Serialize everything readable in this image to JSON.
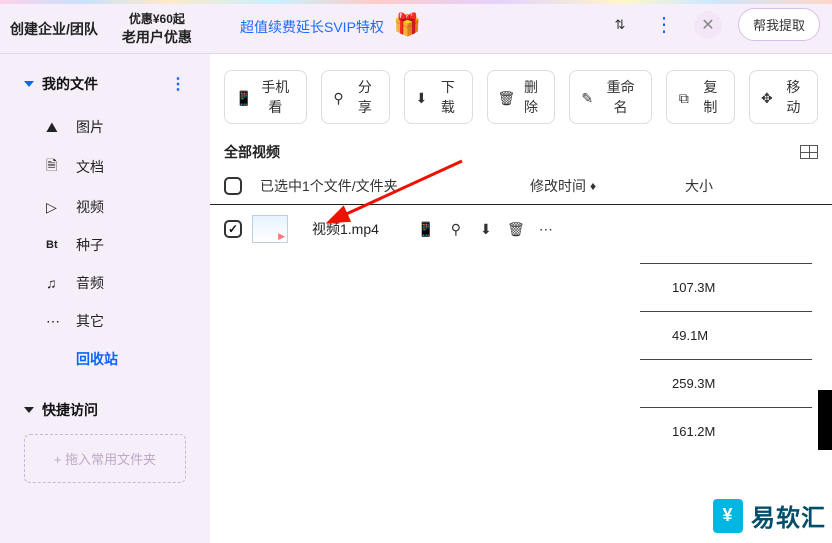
{
  "header": {
    "create_org": "创建企业/团队",
    "promo_top": "优惠¥60起",
    "promo_bottom": "老用户优惠",
    "svip_promo": "超值续费延长SVIP特权",
    "help_placeholder": "帮我提取"
  },
  "sidebar": {
    "my_files_title": "我的文件",
    "items": [
      {
        "icon": "picture-icon",
        "label": "图片"
      },
      {
        "icon": "document-icon",
        "label": "文档"
      },
      {
        "icon": "video-icon",
        "label": "视频"
      },
      {
        "icon": "bt-icon",
        "label": "种子"
      },
      {
        "icon": "audio-icon",
        "label": "音频"
      },
      {
        "icon": "more-icon",
        "label": "其它"
      },
      {
        "icon": "recycle-icon",
        "label": "回收站"
      }
    ],
    "quick_title": "快捷访问",
    "dropzone": "+ 拖入常用文件夹"
  },
  "toolbar": {
    "phone": "手机看",
    "share": "分享",
    "download": "下载",
    "delete": "删除",
    "rename": "重命名",
    "copy": "复制",
    "move": "移动"
  },
  "subheader": {
    "all_video": "全部视频"
  },
  "list": {
    "selected_text": "已选中1个文件/文件夹",
    "col_modified": "修改时间",
    "col_size": "大小"
  },
  "file": {
    "name": "视频1.mp4"
  },
  "sizes": [
    "107.3M",
    "49.1M",
    "259.3M",
    "161.2M"
  ],
  "watermark": "易软汇"
}
